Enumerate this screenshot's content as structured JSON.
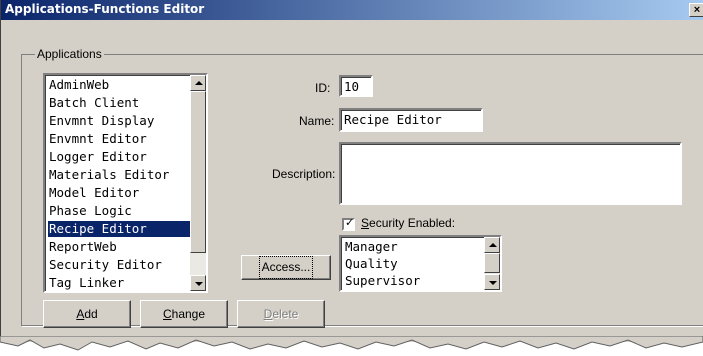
{
  "window": {
    "title": "Applications-Functions Editor",
    "close_glyph": "×"
  },
  "group": {
    "label": "Applications"
  },
  "app_list": {
    "items": [
      "AdminWeb",
      "Batch Client",
      "Envmnt Display",
      "Envmnt Editor",
      "Logger Editor",
      "Materials Editor",
      "Model Editor",
      "Phase Logic",
      "Recipe Editor",
      "ReportWeb",
      "Security Editor",
      "Tag Linker"
    ],
    "selected": "Recipe Editor"
  },
  "fields": {
    "id_label": "ID:",
    "id_value": "10",
    "name_label": "Name:",
    "name_value": "Recipe Editor",
    "description_label": "Description:",
    "description_value": ""
  },
  "security": {
    "checkbox_label": "Security Enabled:",
    "checked": true
  },
  "access": {
    "button_label": "Access...",
    "roles": [
      "Manager",
      "Quality",
      "Supervisor"
    ]
  },
  "buttons": {
    "add": "Add",
    "change": "Change",
    "delete": "Delete"
  }
}
